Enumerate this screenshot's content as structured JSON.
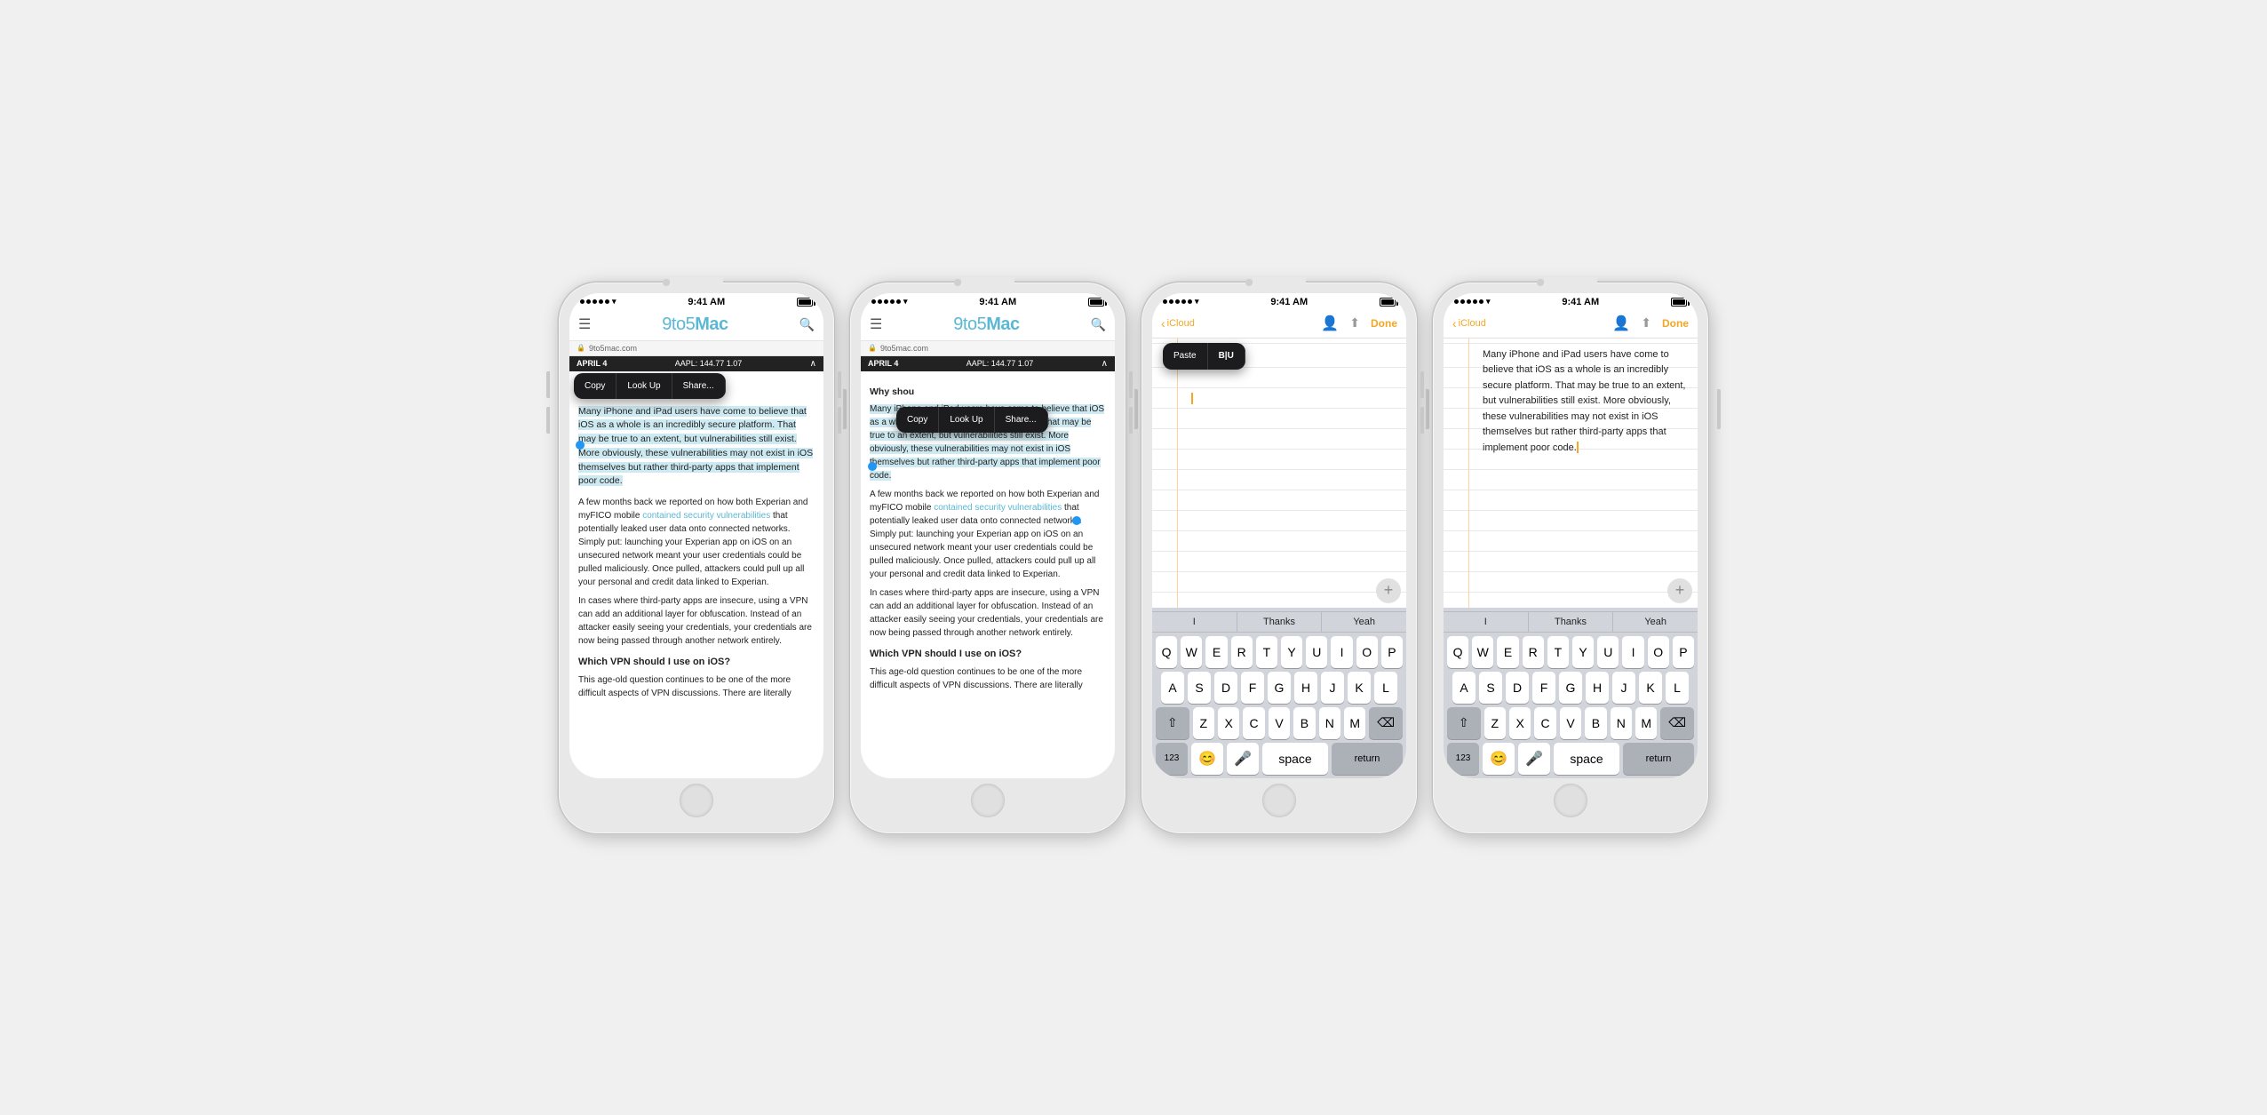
{
  "phones": [
    {
      "id": "phone1",
      "type": "browser",
      "statusBar": {
        "dots": 5,
        "wifi": true,
        "time": "9:41 AM",
        "battery": "full"
      },
      "urlBar": "9to5mac.com",
      "ticker": {
        "date": "APRIL 4",
        "stock": "AAPL: 144.77  1.07",
        "hasChevron": true
      },
      "contextMenu": {
        "visible": true,
        "position": "top",
        "items": [
          "Copy",
          "Look Up",
          "Share..."
        ]
      },
      "hasSelection": true,
      "articleTitle": null,
      "articleIntro": "Many iPhone and iPad users have come to believe that iOS as a whole is an incredibly secure platform. That may be true to an extent, but vulnerabilities still exist. More obviously, these vulnerabilities may not exist in iOS themselves but rather third-party apps that implement poor code.",
      "articleParagraph2": "A few months back we reported on how both Experian and myFICO mobile contained security vulnerabilities that potentially leaked user data onto connected networks. Simply put: launching your Experian app on iOS on an unsecured network meant your user credentials could be pulled maliciously. Once pulled, attackers could pull up all your personal and credit data linked to Experian.",
      "articleParagraph3": "In cases where third-party apps are insecure, using a VPN can add an additional layer for obfuscation. Instead of an attacker easily seeing your credentials, your credentials are now being passed through another network entirely.",
      "articleHeading": "Which VPN should I use on iOS?",
      "articleParagraph4": "This age-old question continues to be one of the more difficult aspects of VPN discussions. There are literally"
    },
    {
      "id": "phone2",
      "type": "browser",
      "statusBar": {
        "dots": 5,
        "wifi": true,
        "time": "9:41 AM",
        "battery": "full"
      },
      "urlBar": "9to5mac.com",
      "ticker": {
        "date": "APRIL 4",
        "stock": "AAPL: 144.77  1.07",
        "hasChevron": true
      },
      "contextMenu": {
        "visible": true,
        "position": "mid",
        "items": [
          "Copy",
          "Look Up",
          "Share..."
        ]
      },
      "hasFullSelection": true,
      "articleTitle": "Why shou",
      "articleIntro": "Many iPhone and iPad users have come to believe that iOS as a whole is an incredibly secure platform. That may be true to an extent, but vulnerabilities still exist. More obviously, these vulnerabilities may not exist in iOS themselves but rather third-party apps that implement poor code.",
      "articleParagraph2": "A few months back we reported on how both Experian and myFICO mobile contained security vulnerabilities that potentially leaked user data onto connected networks. Simply put: launching your Experian app on iOS on an unsecured network meant your user credentials could be pulled maliciously. Once pulled, attackers could pull up all your personal and credit data linked to Experian.",
      "articleParagraph3": "In cases where third-party apps are insecure, using a VPN can add an additional layer for obfuscation. Instead of an attacker easily seeing your credentials, your credentials are now being passed through another network entirely.",
      "articleHeading": "Which VPN should I use on iOS?",
      "articleParagraph4": "This age-old question continues to be one of the more difficult aspects of VPN discussions. There are literally"
    },
    {
      "id": "phone3",
      "type": "notes",
      "statusBar": {
        "dots": 5,
        "wifi": true,
        "time": "9:41 AM",
        "battery": "full"
      },
      "notesHeader": {
        "back": "iCloud",
        "done": "Done",
        "hasPerson": true,
        "hasShare": true
      },
      "pasteMenu": {
        "visible": true,
        "items": [
          "Paste",
          "B|U"
        ]
      },
      "notesContent": "",
      "keyboard": {
        "suggestions": [
          "I",
          "Thanks",
          "Yeah"
        ],
        "rows": [
          [
            "Q",
            "W",
            "E",
            "R",
            "T",
            "Y",
            "U",
            "I",
            "O",
            "P"
          ],
          [
            "A",
            "S",
            "D",
            "F",
            "G",
            "H",
            "J",
            "K",
            "L"
          ],
          [
            "⇧",
            "Z",
            "X",
            "C",
            "V",
            "B",
            "N",
            "M",
            "⌫"
          ],
          [
            "123",
            "😊",
            "🎤",
            "space",
            "return"
          ]
        ]
      }
    },
    {
      "id": "phone4",
      "type": "notes-filled",
      "statusBar": {
        "dots": 5,
        "wifi": true,
        "time": "9:41 AM",
        "battery": "full"
      },
      "notesHeader": {
        "back": "iCloud",
        "done": "Done",
        "hasPerson": true,
        "hasShare": true,
        "personOrange": true
      },
      "notesContent": "Many iPhone and iPad users have come to believe that iOS as a whole is an incredibly secure platform. That may be true to an extent, but vulnerabilities still exist. More obviously, these vulnerabilities may not exist in iOS themselves but rather third-party apps that implement poor code.",
      "keyboard": {
        "suggestions": [
          "I",
          "Thanks",
          "Yeah"
        ],
        "rows": [
          [
            "Q",
            "W",
            "E",
            "R",
            "T",
            "Y",
            "U",
            "I",
            "O",
            "P"
          ],
          [
            "A",
            "S",
            "D",
            "F",
            "G",
            "H",
            "J",
            "K",
            "L"
          ],
          [
            "⇧",
            "Z",
            "X",
            "C",
            "V",
            "B",
            "N",
            "M",
            "⌫"
          ],
          [
            "123",
            "😊",
            "🎤",
            "space",
            "return"
          ]
        ]
      }
    }
  ],
  "contextMenuItems": {
    "copy": "Copy",
    "lookUp": "Look Up",
    "share": "Share..."
  },
  "pasteMenuItems": {
    "paste": "Paste",
    "biu": "B|U"
  },
  "keyboardSuggestions": [
    "I",
    "Thanks",
    "Yeah"
  ],
  "keyboardRows": {
    "row1": [
      "Q",
      "W",
      "E",
      "R",
      "T",
      "Y",
      "U",
      "I",
      "O",
      "P"
    ],
    "row2": [
      "A",
      "S",
      "D",
      "F",
      "G",
      "H",
      "J",
      "K",
      "L"
    ],
    "row3": [
      "Z",
      "X",
      "C",
      "V",
      "B",
      "N",
      "M"
    ],
    "bottomLeft": "123",
    "space": "space",
    "return": "return"
  }
}
